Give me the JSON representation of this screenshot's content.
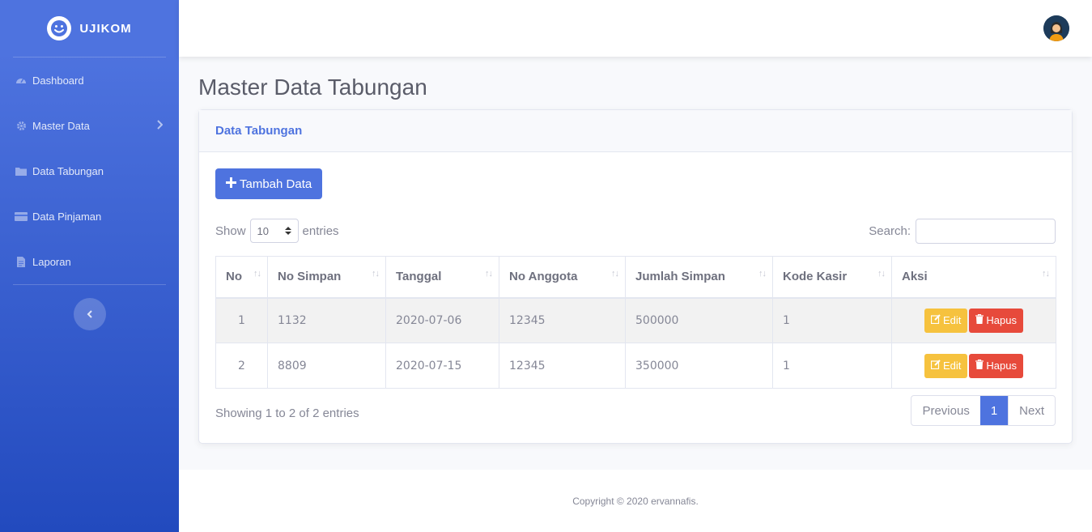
{
  "brand": {
    "name": "UJIKOM"
  },
  "sidebar": {
    "items": [
      {
        "label": "Dashboard",
        "icon": "tachometer-icon"
      },
      {
        "label": "Master Data",
        "icon": "cog-icon"
      },
      {
        "label": "Data Tabungan",
        "icon": "folder-icon"
      },
      {
        "label": "Data Pinjaman",
        "icon": "credit-card-icon"
      },
      {
        "label": "Laporan",
        "icon": "file-icon"
      }
    ],
    "toggle_icon": "chevron-left-icon"
  },
  "topbar": {
    "avatar": "user-avatar"
  },
  "page": {
    "title": "Master Data Tabungan"
  },
  "card": {
    "header": "Data Tabungan",
    "add_button": "Tambah Data",
    "show_label": "Show",
    "entries_value": "10",
    "entries_label": "entries",
    "search_label": "Search:",
    "search_value": ""
  },
  "table": {
    "columns": [
      "No",
      "No Simpan",
      "Tanggal",
      "No Anggota",
      "Jumlah Simpan",
      "Kode Kasir",
      "Aksi"
    ],
    "rows": [
      [
        "1",
        "1132",
        "2020-07-06",
        "12345",
        "500000",
        "1"
      ],
      [
        "2",
        "8809",
        "2020-07-15",
        "12345",
        "350000",
        "1"
      ]
    ],
    "edit_label": "Edit",
    "delete_label": "Hapus"
  },
  "info": "Showing 1 to 2 of 2 entries",
  "pagination": {
    "previous": "Previous",
    "current": "1",
    "next": "Next"
  },
  "footer": "Copyright © 2020 ervannafis.",
  "colors": {
    "primary": "#4e73df",
    "warning": "#f6c23e",
    "danger": "#e74a3b"
  }
}
